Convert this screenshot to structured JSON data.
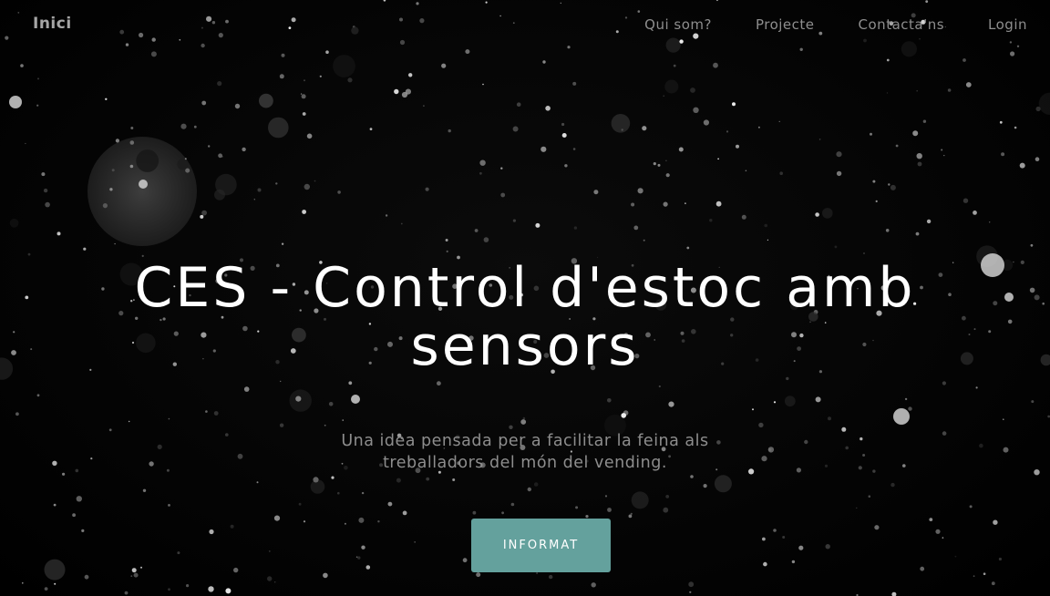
{
  "navbar": {
    "brand": "Inici",
    "links": [
      {
        "label": "Qui som?"
      },
      {
        "label": "Projecte"
      },
      {
        "label": "Contacta'ns"
      },
      {
        "label": "Login"
      }
    ]
  },
  "hero": {
    "title": "CES - Control d'estoc amb sensors",
    "subtitle": "Una idea pensada per a facilitar la feina als treballadors del món del vending.",
    "cta_label": "INFORMAT"
  },
  "colors": {
    "background": "#000000",
    "accent": "#64a19d",
    "title": "#ffffff",
    "nav_text": "#8e8e8e"
  }
}
